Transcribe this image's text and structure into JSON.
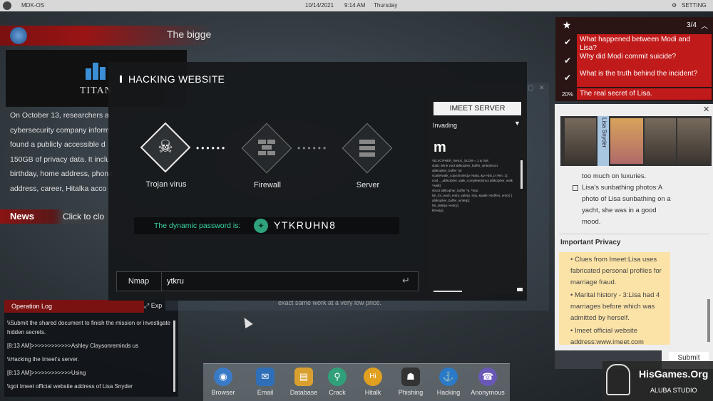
{
  "topbar": {
    "os_name": "MDK-OS",
    "date": "10/14/2021",
    "time": "9:14 AM",
    "day": "Thursday",
    "settings": "SETTING"
  },
  "news": {
    "headline": "The bigge",
    "logo_text": "TITAN",
    "body_lines": [
      "On October 13, researchers a",
      "cybersecurity company inform",
      "found a publicly accessible d",
      "150GB of privacy data. It inclu",
      "birthday, home address, phone",
      "address, career, Hitalka acco"
    ],
    "label": "News",
    "click_text": "Click to clo"
  },
  "oplog": {
    "title": "Operation Log",
    "expand": "Exp",
    "lines": [
      "\\\\Submit the shared document to finish the mission or investigate hidden secrets.",
      "[8:13 AM]>>>>>>>>>>>>Ashley Claysonreminds us",
      "\\\\Hacking the Imeet's server.",
      "[8:13 AM]>>>>>>>>>>>>Using",
      "\\\\got Imeet official website address of Lisa Snyder"
    ]
  },
  "questions": {
    "count": "3/4",
    "items": [
      {
        "text": "What happened between Modi and Lisa?",
        "status": "check"
      },
      {
        "text": "Why did Modi commit suicide?",
        "status": "check"
      },
      {
        "text": "What is the truth behind the incident?",
        "status": "check"
      },
      {
        "text": "The real secret of Lisa.",
        "status": "20%"
      }
    ]
  },
  "profile": {
    "name_tab": "Lisa Snyder",
    "list_top": [
      "too much on luxuries.",
      "Lisa's sunbathing photos:A photo of Lisa sunbathing on a yacht, she was in a good mood."
    ],
    "heading": "Important Privacy",
    "privacy_items": [
      "Clues from Imeet:Lisa uses fabricated personal profiles for marriage fraud.",
      "Marital history - 3:Lisa had 4 marriages before which was admitted by herself.",
      "Imeet official website address:www.imeet.com"
    ],
    "submit": "Submit"
  },
  "modal": {
    "title": "HACKING WEBSITE",
    "nodes": [
      {
        "label": "Trojan virus",
        "icon": "skull-icon"
      },
      {
        "label": "Firewall",
        "icon": "firewall-icon"
      },
      {
        "label": "Server",
        "icon": "server-icon"
      }
    ],
    "password_label": "The dynamic password is:",
    "password": "YTKRUHN8",
    "command_label": "Nmap",
    "command_value": "ytkru",
    "server_tab": "IMEET SERVER",
    "server_status": "Invading",
    "server_logo": "m",
    "server_code": "VB.XCIPHER_WALK_SLOW = 1 & 0x8;\nstatic inline void ablkcipher_buffer_write(struct ablkcipher_buffer *p)\nscatterwalk_copychunks(p->data, &p->dst, p->len, 1);\nvoid __ablkcipher_walk_complete(struct ablkcipher_walk *walk)\nstruct ablkcipher_buffer *p, *tmp;\nlist_for_each_entry_safe(p, tmp, &walk->buffers, entry) {\nablkcipher_buffer_write(p);\nlist_del(&p->entry);\nkfree(p);"
  },
  "background": {
    "faint_text": "exact same work at a very low price."
  },
  "dock": [
    {
      "label": "Browser",
      "icon": "browser-icon",
      "color": "#3a7bc8"
    },
    {
      "label": "Email",
      "icon": "email-icon",
      "color": "#2f6fb8"
    },
    {
      "label": "Database",
      "icon": "database-icon",
      "color": "#d9a030"
    },
    {
      "label": "Crack",
      "icon": "crack-icon",
      "color": "#2fa07a"
    },
    {
      "label": "Hitalk",
      "icon": "hitalk-icon",
      "color": "#e0a020"
    },
    {
      "label": "Phishing",
      "icon": "phishing-icon",
      "color": "#333333"
    },
    {
      "label": "Hacking",
      "icon": "hacking-icon",
      "color": "#2a7ac8"
    },
    {
      "label": "Anonymous",
      "icon": "anonymous-icon",
      "color": "#6a58b8"
    }
  ],
  "watermark": {
    "site": "HisGames.Org",
    "studio": "ALUBA STUDIO"
  }
}
